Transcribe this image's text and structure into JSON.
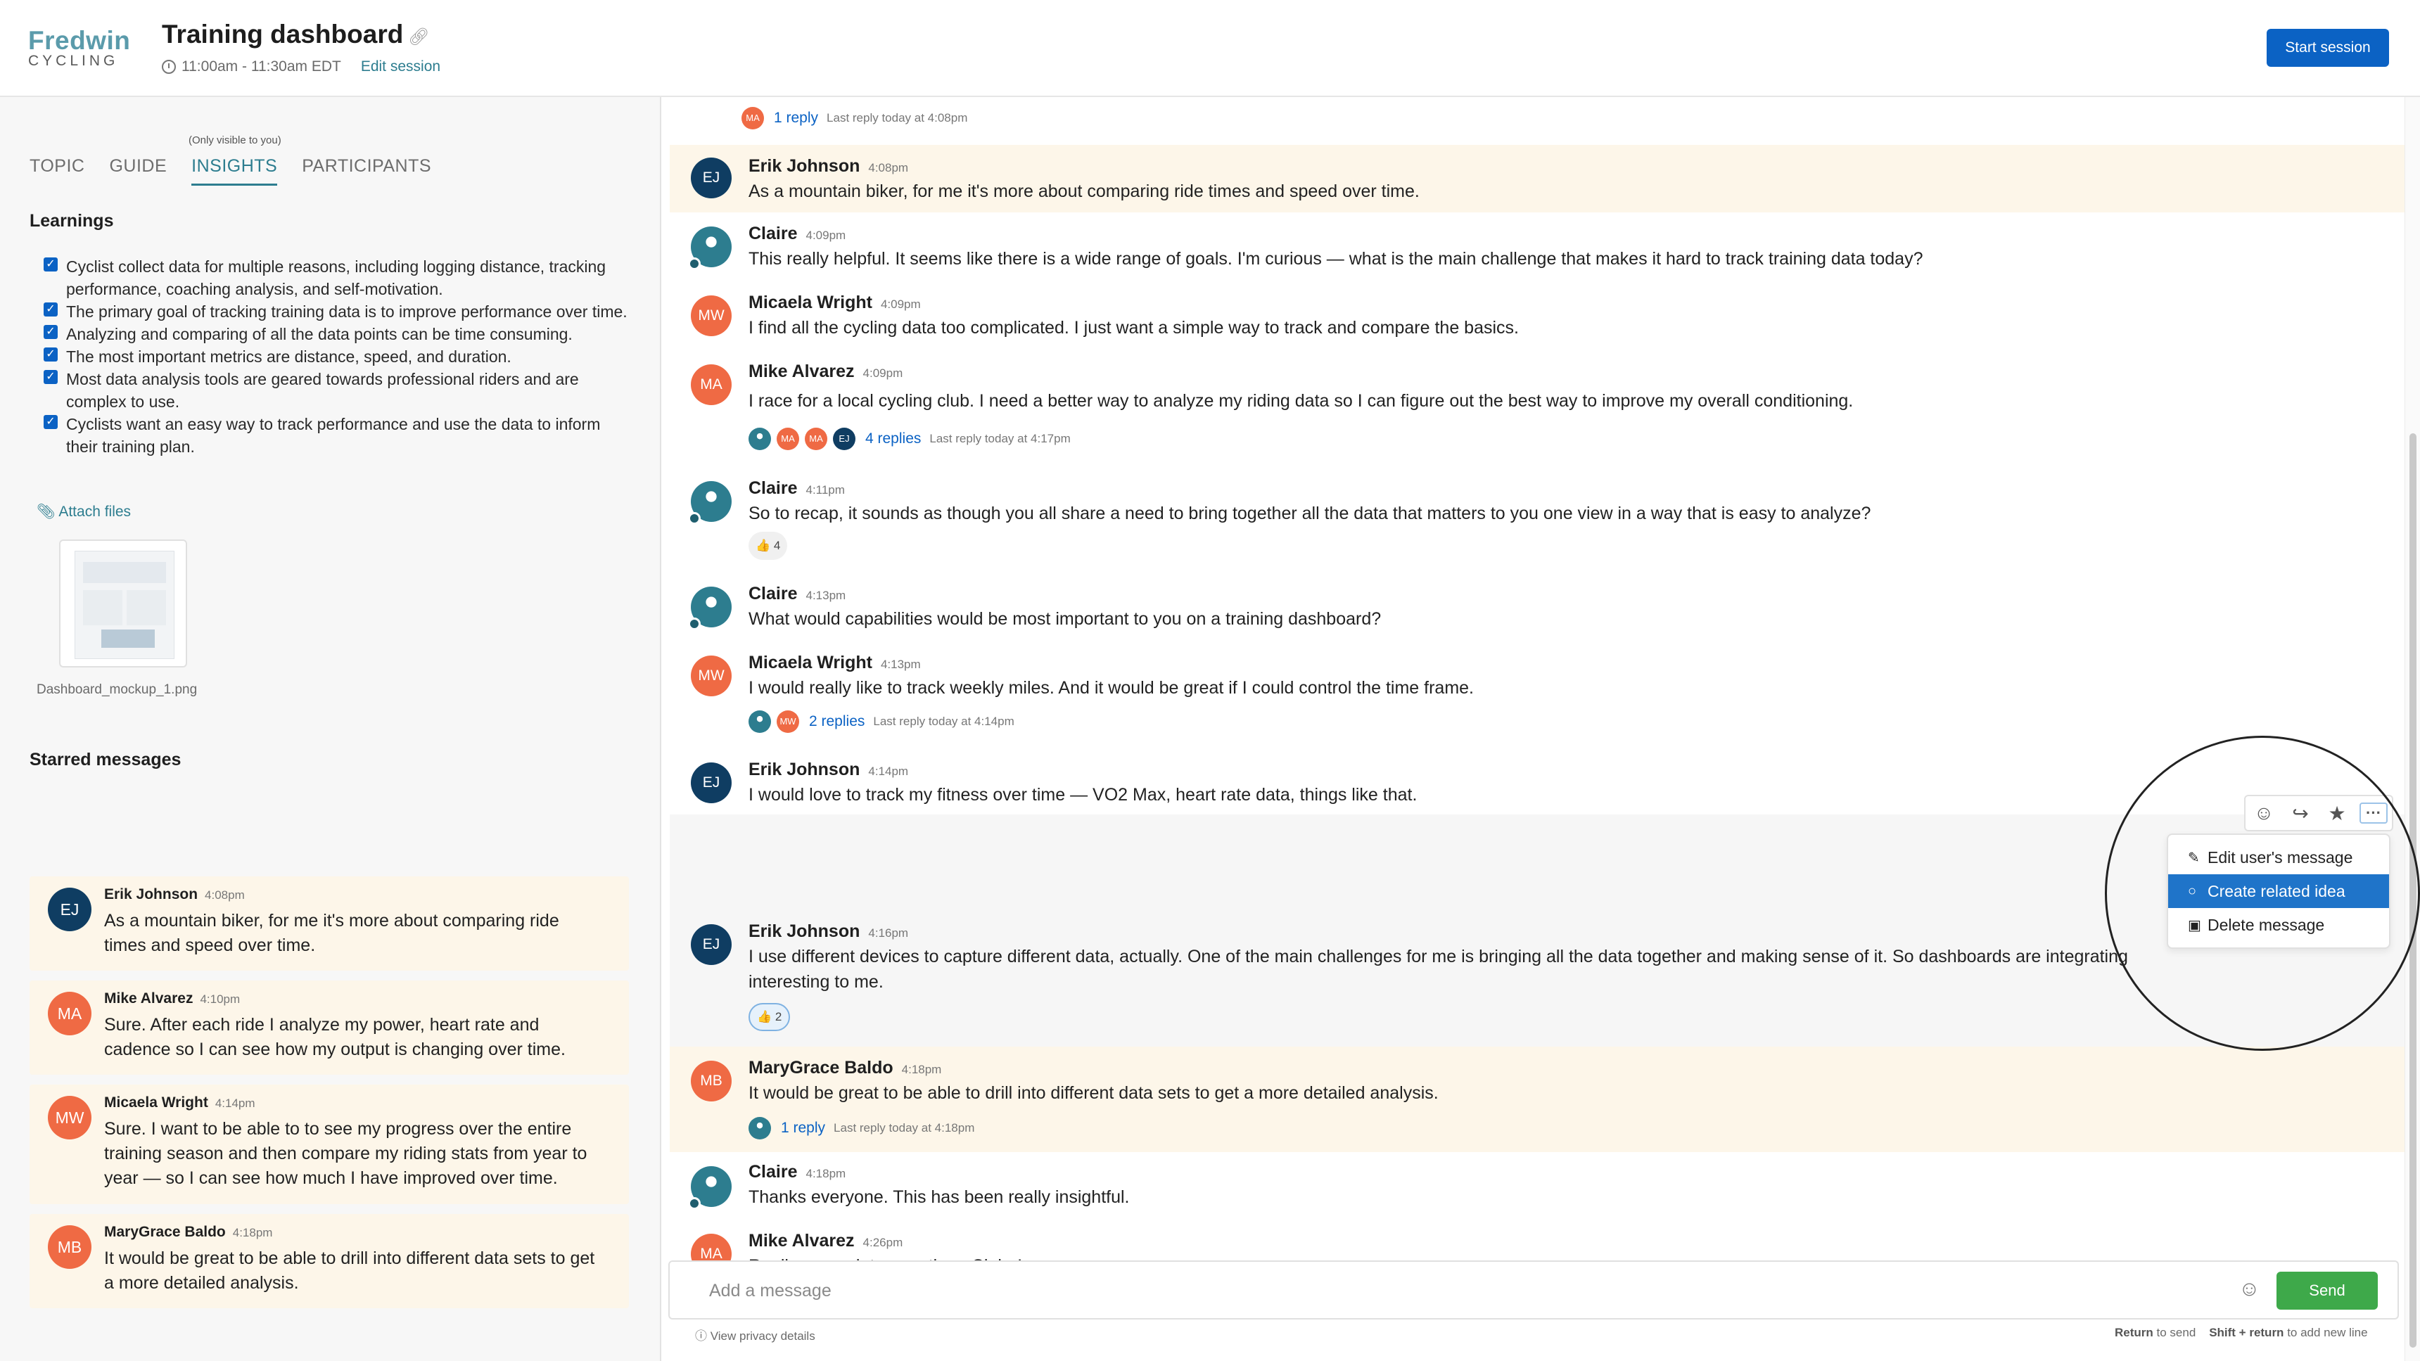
{
  "header": {
    "logo_line1": "Fredwin",
    "logo_line2": "CYCLING",
    "title": "Training dashboard",
    "time_range": "11:00am - 11:30am EDT",
    "edit_session": "Edit session",
    "start_session": "Start session"
  },
  "sidebar": {
    "visibility_note": "(Only visible to you)",
    "tabs": [
      {
        "label": "TOPIC"
      },
      {
        "label": "GUIDE"
      },
      {
        "label": "INSIGHTS"
      },
      {
        "label": "PARTICIPANTS"
      }
    ],
    "active_tab": "INSIGHTS",
    "learnings_heading": "Learnings",
    "learnings": [
      {
        "text": "Cyclist collect data for multiple reasons, including logging distance, tracking performance, coaching analysis,  and self-motivation.",
        "checked": true
      },
      {
        "text": "The primary goal of tracking training data is to improve performance over time.",
        "checked": true
      },
      {
        "text": "Analyzing and comparing of all the data points can be time consuming.",
        "checked": true
      },
      {
        "text": "The most important metrics are distance, speed, and duration.",
        "checked": true
      },
      {
        "text": "Most data analysis tools are geared towards professional riders and are complex to use.",
        "checked": true
      },
      {
        "text": "Cyclists want an easy way to track performance and use the data to inform their training plan.",
        "checked": true
      }
    ],
    "attach_label": "Attach files",
    "attachment_name": "Dashboard_mockup_1.png",
    "starred_heading": "Starred messages",
    "starred": [
      {
        "initials": "EJ",
        "color": "#0f3d62",
        "name": "Erik Johnson",
        "time": "4:08pm",
        "text": "As a mountain biker, for me it's more about comparing ride times and speed over time."
      },
      {
        "initials": "MA",
        "color": "#ef6a44",
        "name": "Mike Alvarez",
        "time": "4:10pm",
        "text": "Sure. After each ride I analyze my power, heart rate and cadence so I can see how my output is changing over time."
      },
      {
        "initials": "MW",
        "color": "#ef6a44",
        "name": "Micaela Wright",
        "time": "4:14pm",
        "text": "Sure. I want to be able to to see my progress over the entire training season and then compare my riding stats from year to year — so I can see how much I have improved over time."
      },
      {
        "initials": "MB",
        "color": "#ef6a44",
        "name": "MaryGrace Baldo",
        "time": "4:18pm",
        "text": "It would be great to be able to drill into different data sets to get a more detailed analysis."
      }
    ]
  },
  "chat": {
    "top_thread": {
      "avatar": "MA",
      "link": "1 reply",
      "meta": "Last reply today at 4:08pm"
    },
    "messages": [
      {
        "avatar": "EJ",
        "name": "Erik Johnson",
        "time": "4:08pm",
        "text": "As a mountain biker, for me it's more about comparing ride times and speed over time."
      },
      {
        "avatar": "photo",
        "name": "Claire",
        "time": "4:09pm",
        "text": "This really helpful. It seems like there is a wide range of goals. I'm curious — what is the main challenge that makes it hard to track training data today?"
      },
      {
        "avatar": "MW",
        "name": "Micaela Wright",
        "time": "4:09pm",
        "text": "I find all the cycling data too complicated. I just want a simple way to track and compare the basics."
      },
      {
        "avatar": "MA",
        "name": "Mike Alvarez",
        "time": "4:09pm",
        "text": "I race for a local cycling club. I need a better way to analyze my riding data so I can figure out the best way to improve my overall conditioning.",
        "thread": {
          "avatars": [
            "photo",
            "MA",
            "MA",
            "EJ"
          ],
          "link": "4 replies",
          "meta": "Last reply today at 4:17pm"
        }
      },
      {
        "avatar": "photo",
        "name": "Claire",
        "time": "4:11pm",
        "text": "So to recap, it sounds as though you all share a need to bring together all the data that matters to you one view in a way that is easy to analyze?",
        "reaction": "👍 4"
      },
      {
        "avatar": "photo",
        "name": "Claire",
        "time": "4:13pm",
        "text": "What would capabilities would be most important to you on a training dashboard?"
      },
      {
        "avatar": "MW",
        "name": "Micaela Wright",
        "time": "4:13pm",
        "text": "I would really like to track weekly miles. And it would be great if I could control the time frame.",
        "thread": {
          "avatars": [
            "photo",
            "MW"
          ],
          "link": "2 replies",
          "meta": "Last reply today at 4:14pm"
        }
      },
      {
        "avatar": "EJ",
        "name": "Erik Johnson",
        "time": "4:14pm",
        "text": "I would love to track my fitness over time — VO2 Max, heart rate data, things like that."
      },
      {
        "avatar": "EJ",
        "name": "Erik Johnson",
        "time": "4:16pm",
        "text": "I use different devices to capture different data, actually. One of the main challenges for me is bringing all the data together and making sense of it. So dashboards are integrating interesting to me.",
        "reaction": "👍 2"
      },
      {
        "avatar": "MB",
        "name": "MaryGrace Baldo",
        "time": "4:18pm",
        "text": "It would be great to be able to drill into different data sets to get a more detailed analysis.",
        "thread": {
          "avatars": [
            "photo"
          ],
          "link": "1 reply",
          "meta": "Last reply today at 4:18pm"
        }
      },
      {
        "avatar": "photo",
        "name": "Claire",
        "time": "4:18pm",
        "text": "Thanks everyone. This has been really insightful."
      },
      {
        "avatar": "MA",
        "name": "Mike Alvarez",
        "time": "4:26pm",
        "text": "Really appreciate your time, Claire!"
      }
    ],
    "toolbar_icons": [
      "emoji-add-icon",
      "forward-icon",
      "star-icon",
      "more-icon"
    ],
    "context_menu": [
      {
        "label": "Edit user's message",
        "icon": "pencil-icon"
      },
      {
        "label": "Create related idea",
        "icon": "lightbulb-icon",
        "active": true
      },
      {
        "label": "Delete message",
        "icon": "trash-icon"
      }
    ]
  },
  "composer": {
    "placeholder": "Add a message",
    "send_label": "Send",
    "privacy": "View privacy details",
    "hint_key1": "Return",
    "hint_text1": "to send",
    "hint_key2": "Shift + return",
    "hint_text2": "to add new line"
  },
  "colors": {
    "accent_teal": "#2d7d8f",
    "primary_blue": "#0b62c4",
    "send_green": "#3ea94a",
    "highlight_row": "#fdf6e9",
    "avatar_navy": "#0f3d62",
    "avatar_orange": "#ef6a44"
  }
}
